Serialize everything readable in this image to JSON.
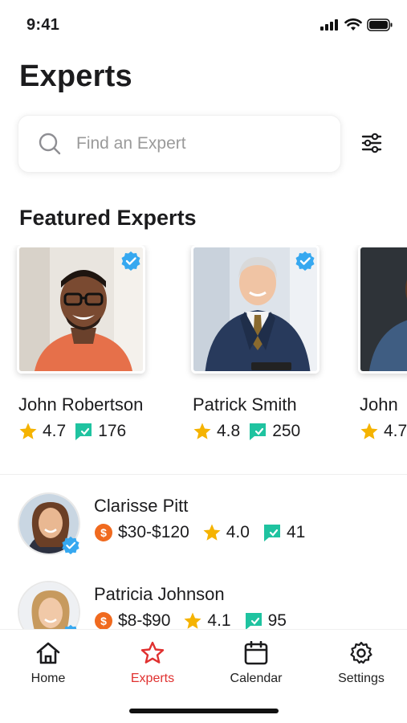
{
  "status_bar": {
    "time": "9:41",
    "icons": [
      "signal-icon",
      "wifi-icon",
      "battery-icon"
    ]
  },
  "page": {
    "title": "Experts"
  },
  "search": {
    "placeholder": "Find an Expert",
    "value": "",
    "icon": "search-icon",
    "filter_icon": "filter-sliders-icon"
  },
  "featured": {
    "title": "Featured Experts",
    "experts": [
      {
        "name": "John Robertson",
        "rating": "4.7",
        "reviews": "176",
        "verified": true
      },
      {
        "name": "Patrick Smith",
        "rating": "4.8",
        "reviews": "250",
        "verified": true
      },
      {
        "name": "John",
        "rating": "4.7",
        "reviews": "",
        "verified": false
      }
    ]
  },
  "experts_list": [
    {
      "name": "Clarisse Pitt",
      "price": "$30-$120",
      "rating": "4.0",
      "reviews": "41",
      "verified": true
    },
    {
      "name": "Patricia Johnson",
      "price": "$8-$90",
      "rating": "4.1",
      "reviews": "95",
      "verified": true
    }
  ],
  "tabs": [
    {
      "label": "Home",
      "icon": "home-icon",
      "active": false
    },
    {
      "label": "Experts",
      "icon": "star-outline-icon",
      "active": true
    },
    {
      "label": "Calendar",
      "icon": "calendar-icon",
      "active": false
    },
    {
      "label": "Settings",
      "icon": "gear-icon",
      "active": false
    }
  ],
  "colors": {
    "accent": "#e0302f",
    "star": "#f5b301",
    "reviews": "#1fc3a0",
    "verified": "#36a8f0",
    "price": "#f06a1f"
  }
}
